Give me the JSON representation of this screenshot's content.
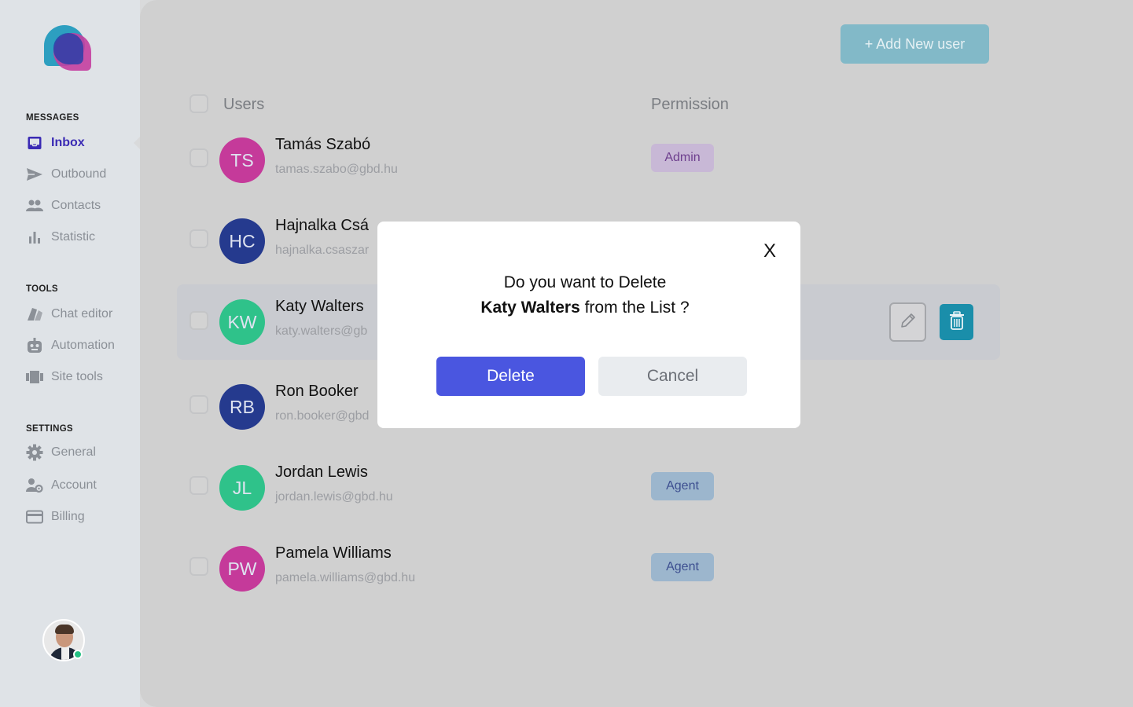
{
  "sidebar": {
    "sections": [
      {
        "title": "MESSAGES",
        "items": [
          {
            "label": "Inbox",
            "icon": "inbox-icon",
            "active": true
          },
          {
            "label": "Outbound",
            "icon": "send-icon"
          },
          {
            "label": "Contacts",
            "icon": "contacts-icon"
          },
          {
            "label": "Statistic",
            "icon": "bar-chart-icon"
          }
        ]
      },
      {
        "title": "TOOLS",
        "items": [
          {
            "label": "Chat editor",
            "icon": "chat-editor-icon"
          },
          {
            "label": "Automation",
            "icon": "robot-icon"
          },
          {
            "label": "Site tools",
            "icon": "site-tools-icon"
          }
        ]
      },
      {
        "title": "SETTINGS",
        "items": [
          {
            "label": "General",
            "icon": "gear-icon"
          },
          {
            "label": "Account",
            "icon": "account-settings-icon"
          },
          {
            "label": "Billing",
            "icon": "credit-card-icon"
          }
        ]
      }
    ],
    "accent_color": "#3a2ab4"
  },
  "toolbar": {
    "add_user_label": "+ Add New user"
  },
  "table": {
    "headers": {
      "users": "Users",
      "permission": "Permission"
    },
    "rows": [
      {
        "initials": "TS",
        "name": "Tamás Szabó",
        "email": "tamas.szabo@gbd.hu",
        "permission": "Admin",
        "avatar_color": "#c53a9a"
      },
      {
        "initials": "HC",
        "name": "Hajnalka Csá",
        "email": "hajnalka.csaszar",
        "permission": "",
        "avatar_color": "#253a8e"
      },
      {
        "initials": "KW",
        "name": "Katy Walters",
        "email": "katy.walters@gb",
        "permission": "",
        "avatar_color": "#2fc28a"
      },
      {
        "initials": "RB",
        "name": "Ron Booker",
        "email": "ron.booker@gbd",
        "permission": "",
        "avatar_color": "#253a8e"
      },
      {
        "initials": "JL",
        "name": "Jordan Lewis",
        "email": "jordan.lewis@gbd.hu",
        "permission": "Agent",
        "avatar_color": "#2fc28a"
      },
      {
        "initials": "PW",
        "name": "Pamela Williams",
        "email": "pamela.williams@gbd.hu",
        "permission": "Agent",
        "avatar_color": "#c53a9a"
      }
    ]
  },
  "modal": {
    "close_label": "X",
    "message_line1": "Do you want to Delete",
    "message_name": "Katy Walters",
    "message_suffix": " from the List ?",
    "delete_label": "Delete",
    "cancel_label": "Cancel"
  }
}
